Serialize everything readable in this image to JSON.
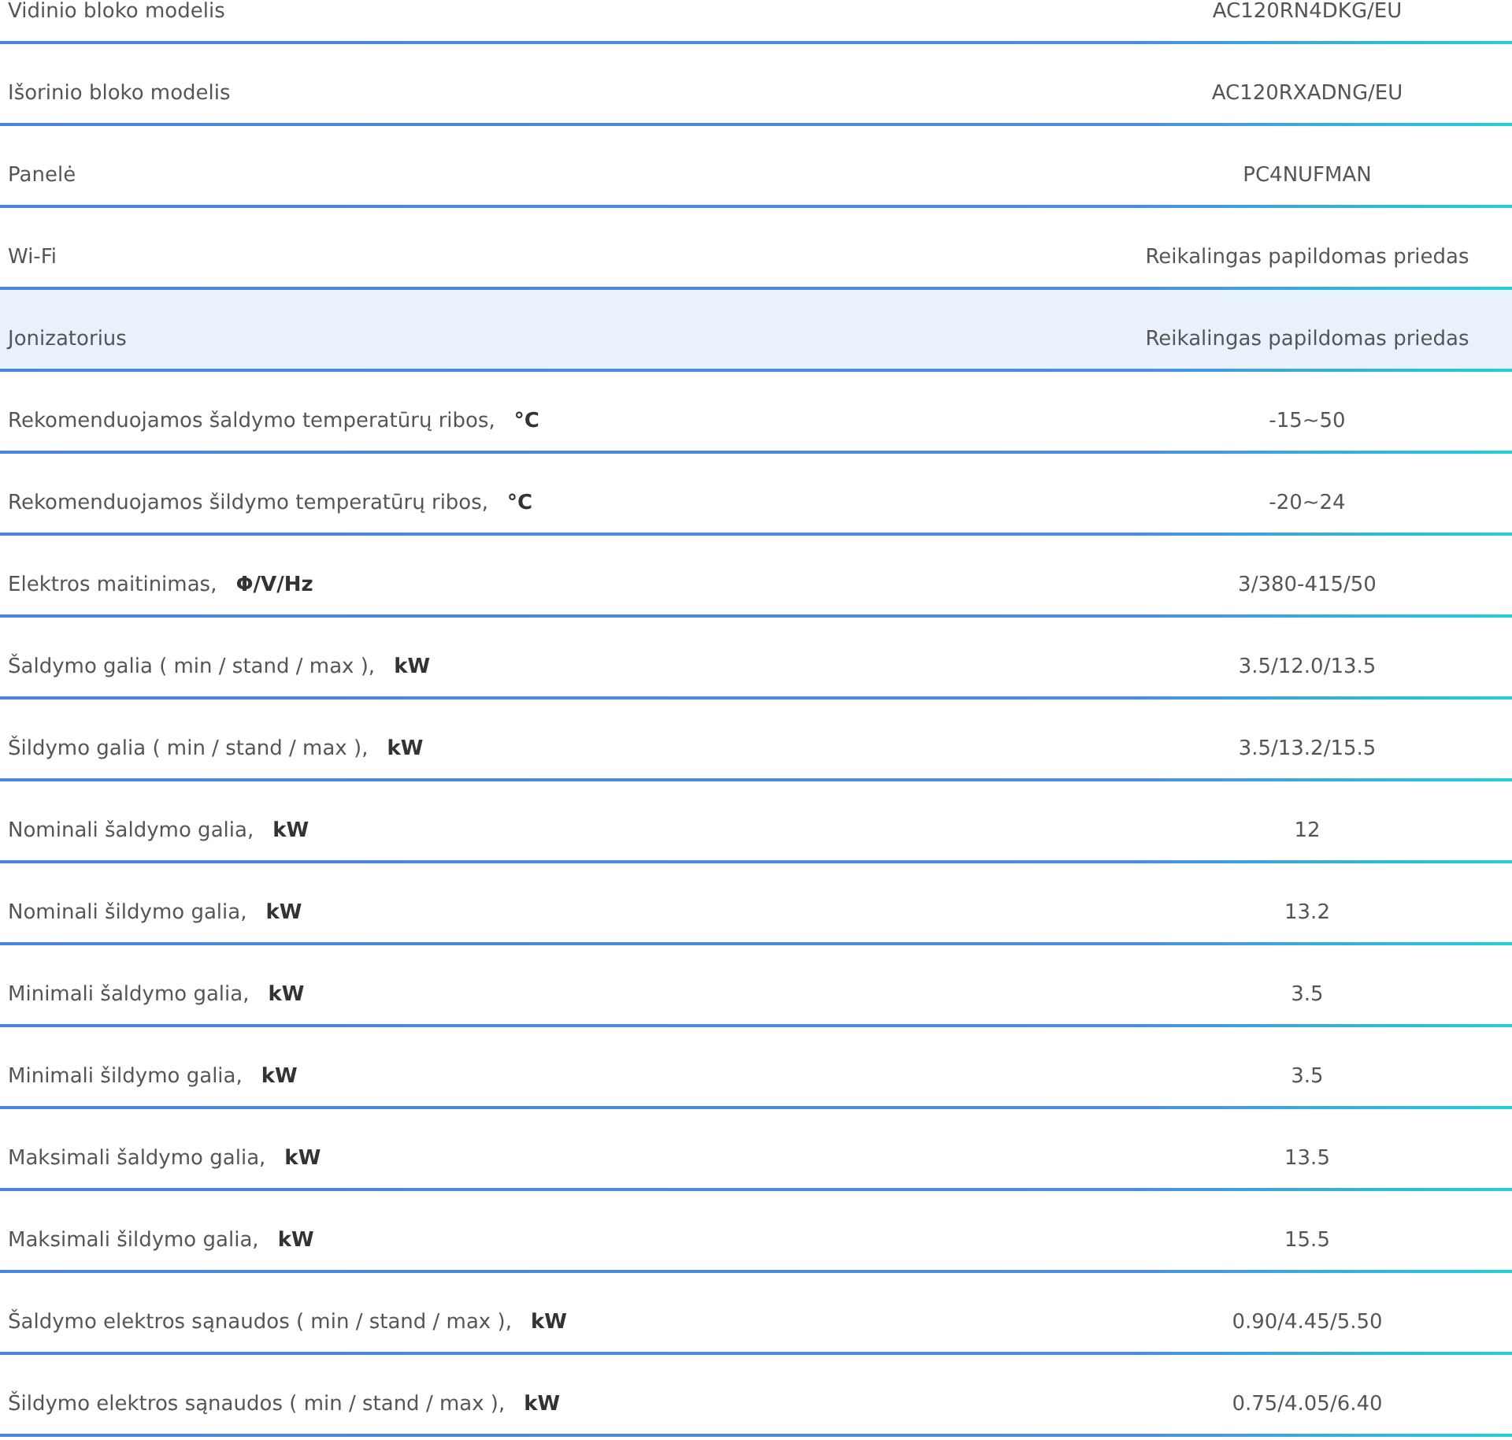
{
  "specs": [
    {
      "label": "Vidinio bloko modelis",
      "value": "AC120RN4DKG/EU",
      "highlighted": false
    },
    {
      "label": "Išorinio bloko modelis",
      "value": "AC120RXADNG/EU",
      "highlighted": false
    },
    {
      "label": "Panelė",
      "value": "PC4NUFMAN",
      "highlighted": false
    },
    {
      "label": "Wi-Fi",
      "value": "Reikalingas papildomas priedas",
      "highlighted": false
    },
    {
      "label": "Jonizatorius",
      "value": "Reikalingas papildomas priedas",
      "highlighted": true
    },
    {
      "label": "Rekomenduojamos šaldymo temperatūrų ribos,",
      "unit": "°C",
      "value": "-15~50",
      "highlighted": false
    },
    {
      "label": "Rekomenduojamos šildymo temperatūrų ribos,",
      "unit": "°C",
      "value": "-20~24",
      "highlighted": false
    },
    {
      "label": "Elektros maitinimas,",
      "unit": "Φ/V/Hz",
      "value": "3/380-415/50",
      "highlighted": false
    },
    {
      "label": "Šaldymo galia ( min / stand / max ),",
      "unit": "kW",
      "value": "3.5/12.0/13.5",
      "highlighted": false
    },
    {
      "label": "Šildymo galia ( min / stand / max ),",
      "unit": "kW",
      "value": "3.5/13.2/15.5",
      "highlighted": false
    },
    {
      "label": "Nominali šaldymo galia,",
      "unit": "kW",
      "value": "12",
      "highlighted": false
    },
    {
      "label": "Nominali šildymo galia,",
      "unit": "kW",
      "value": "13.2",
      "highlighted": false
    },
    {
      "label": "Minimali šaldymo galia,",
      "unit": "kW",
      "value": "3.5",
      "highlighted": false
    },
    {
      "label": "Minimali šildymo galia,",
      "unit": "kW",
      "value": "3.5",
      "highlighted": false
    },
    {
      "label": "Maksimali šaldymo galia,",
      "unit": "kW",
      "value": "13.5",
      "highlighted": false
    },
    {
      "label": "Maksimali šildymo galia,",
      "unit": "kW",
      "value": "15.5",
      "highlighted": false
    },
    {
      "label": "Šaldymo elektros sąnaudos ( min / stand / max ),",
      "unit": "kW",
      "value": "0.90/4.45/5.50",
      "highlighted": false
    },
    {
      "label": "Šildymo elektros sąnaudos ( min / stand / max ),",
      "unit": "kW",
      "value": "0.75/4.05/6.40",
      "highlighted": false
    }
  ]
}
